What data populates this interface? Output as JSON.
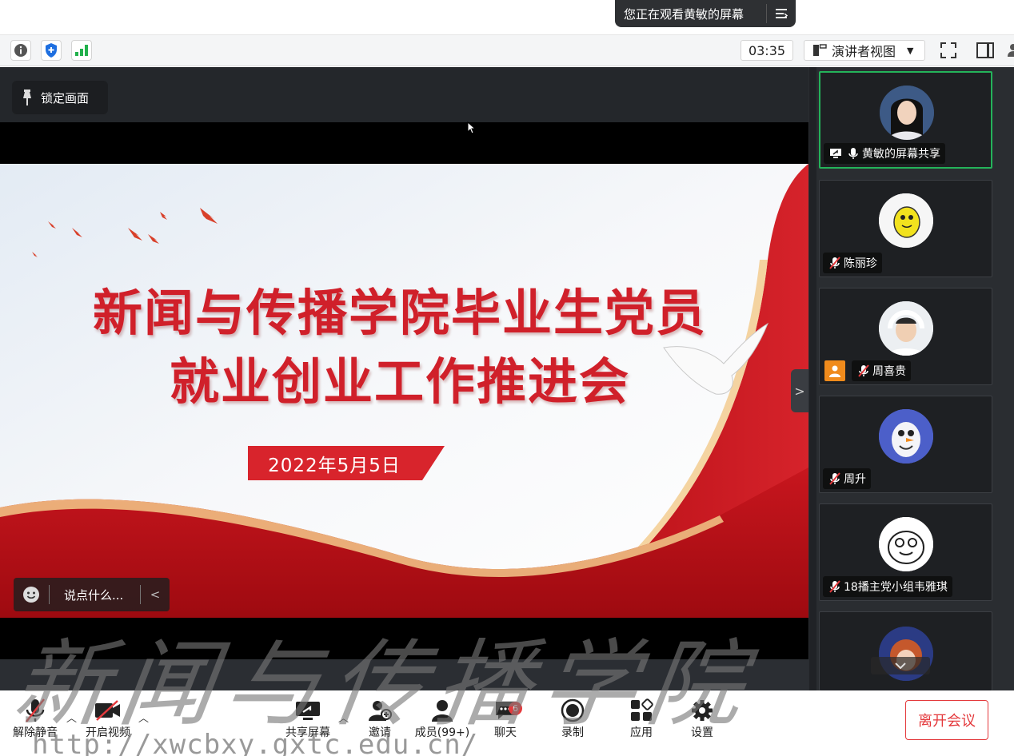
{
  "banner": {
    "text": "您正在观看黄敏的屏幕"
  },
  "toolbar": {
    "timer": "03:35",
    "view_mode": "演讲者视图"
  },
  "stage": {
    "lock_label": "锁定画面",
    "chat_placeholder": "说点什么...",
    "slide": {
      "title_line1": "新闻与传播学院毕业生党员",
      "title_line2": "就业创业工作推进会",
      "date": "2022年5月5日"
    }
  },
  "participants": [
    {
      "name": "黄敏的屏幕共享",
      "sharing": true,
      "mic": "on"
    },
    {
      "name": "陈丽珍",
      "mic": "muted"
    },
    {
      "name": "周喜贵",
      "mic": "muted",
      "host_badge": true
    },
    {
      "name": "周升",
      "mic": "muted"
    },
    {
      "name": "18播主党小组韦雅琪",
      "mic": "muted"
    }
  ],
  "bottom_bar": {
    "unmute": "解除静音",
    "start_video": "开启视频",
    "share_screen": "共享屏幕",
    "invite": "邀请",
    "members": "成员(99+)",
    "chat": "聊天",
    "chat_badge": "6",
    "record": "录制",
    "apps": "应用",
    "settings": "设置",
    "leave": "离开会议"
  },
  "watermark": {
    "calligraphy": "新闻与传播学院",
    "url": "http://xwcbxy.gxtc.edu.cn/"
  },
  "colors": {
    "accent_red": "#d0202a",
    "leave_red": "#e4393c",
    "active_green": "#24b35a"
  }
}
